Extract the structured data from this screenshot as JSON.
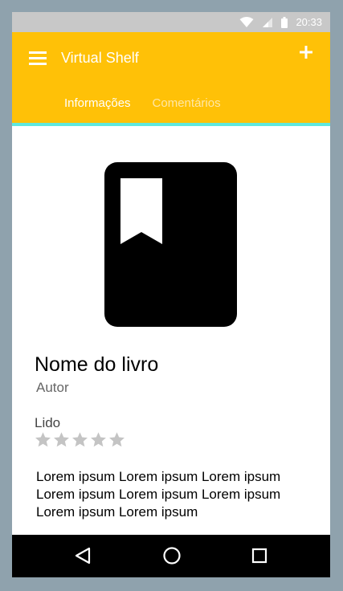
{
  "status_bar": {
    "time": "20:33"
  },
  "app_bar": {
    "title": "Virtual Shelf",
    "color": "#ffc107"
  },
  "tabs": [
    {
      "label": "Informações",
      "active": true
    },
    {
      "label": "Comentários",
      "active": false
    }
  ],
  "book": {
    "title": "Nome do livro",
    "author": "Autor",
    "status": "Lido",
    "rating": 0,
    "max_rating": 5,
    "description": "Lorem ipsum Lorem ipsum Lorem ipsum Lorem ipsum Lorem ipsum Lorem ipsum Lorem ipsum Lorem ipsum"
  },
  "icons": {
    "menu": "hamburger-menu-icon",
    "add": "plus-icon",
    "book": "book-bookmark-icon",
    "back": "triangle-back-icon",
    "home": "circle-home-icon",
    "recents": "square-recents-icon"
  }
}
